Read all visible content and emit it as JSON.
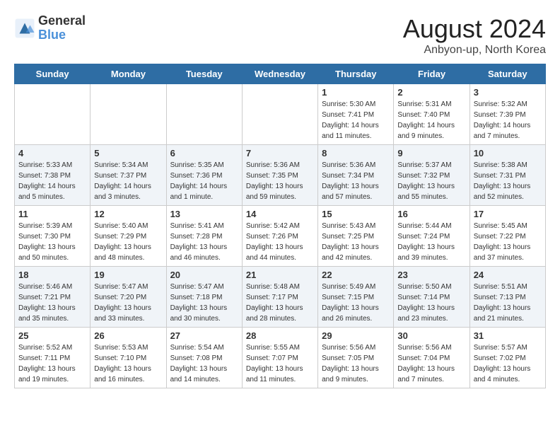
{
  "header": {
    "logo_line1": "General",
    "logo_line2": "Blue",
    "month_year": "August 2024",
    "location": "Anbyon-up, North Korea"
  },
  "days_of_week": [
    "Sunday",
    "Monday",
    "Tuesday",
    "Wednesday",
    "Thursday",
    "Friday",
    "Saturday"
  ],
  "weeks": [
    [
      {
        "day": "",
        "info": ""
      },
      {
        "day": "",
        "info": ""
      },
      {
        "day": "",
        "info": ""
      },
      {
        "day": "",
        "info": ""
      },
      {
        "day": "1",
        "info": "Sunrise: 5:30 AM\nSunset: 7:41 PM\nDaylight: 14 hours\nand 11 minutes."
      },
      {
        "day": "2",
        "info": "Sunrise: 5:31 AM\nSunset: 7:40 PM\nDaylight: 14 hours\nand 9 minutes."
      },
      {
        "day": "3",
        "info": "Sunrise: 5:32 AM\nSunset: 7:39 PM\nDaylight: 14 hours\nand 7 minutes."
      }
    ],
    [
      {
        "day": "4",
        "info": "Sunrise: 5:33 AM\nSunset: 7:38 PM\nDaylight: 14 hours\nand 5 minutes."
      },
      {
        "day": "5",
        "info": "Sunrise: 5:34 AM\nSunset: 7:37 PM\nDaylight: 14 hours\nand 3 minutes."
      },
      {
        "day": "6",
        "info": "Sunrise: 5:35 AM\nSunset: 7:36 PM\nDaylight: 14 hours\nand 1 minute."
      },
      {
        "day": "7",
        "info": "Sunrise: 5:36 AM\nSunset: 7:35 PM\nDaylight: 13 hours\nand 59 minutes."
      },
      {
        "day": "8",
        "info": "Sunrise: 5:36 AM\nSunset: 7:34 PM\nDaylight: 13 hours\nand 57 minutes."
      },
      {
        "day": "9",
        "info": "Sunrise: 5:37 AM\nSunset: 7:32 PM\nDaylight: 13 hours\nand 55 minutes."
      },
      {
        "day": "10",
        "info": "Sunrise: 5:38 AM\nSunset: 7:31 PM\nDaylight: 13 hours\nand 52 minutes."
      }
    ],
    [
      {
        "day": "11",
        "info": "Sunrise: 5:39 AM\nSunset: 7:30 PM\nDaylight: 13 hours\nand 50 minutes."
      },
      {
        "day": "12",
        "info": "Sunrise: 5:40 AM\nSunset: 7:29 PM\nDaylight: 13 hours\nand 48 minutes."
      },
      {
        "day": "13",
        "info": "Sunrise: 5:41 AM\nSunset: 7:28 PM\nDaylight: 13 hours\nand 46 minutes."
      },
      {
        "day": "14",
        "info": "Sunrise: 5:42 AM\nSunset: 7:26 PM\nDaylight: 13 hours\nand 44 minutes."
      },
      {
        "day": "15",
        "info": "Sunrise: 5:43 AM\nSunset: 7:25 PM\nDaylight: 13 hours\nand 42 minutes."
      },
      {
        "day": "16",
        "info": "Sunrise: 5:44 AM\nSunset: 7:24 PM\nDaylight: 13 hours\nand 39 minutes."
      },
      {
        "day": "17",
        "info": "Sunrise: 5:45 AM\nSunset: 7:22 PM\nDaylight: 13 hours\nand 37 minutes."
      }
    ],
    [
      {
        "day": "18",
        "info": "Sunrise: 5:46 AM\nSunset: 7:21 PM\nDaylight: 13 hours\nand 35 minutes."
      },
      {
        "day": "19",
        "info": "Sunrise: 5:47 AM\nSunset: 7:20 PM\nDaylight: 13 hours\nand 33 minutes."
      },
      {
        "day": "20",
        "info": "Sunrise: 5:47 AM\nSunset: 7:18 PM\nDaylight: 13 hours\nand 30 minutes."
      },
      {
        "day": "21",
        "info": "Sunrise: 5:48 AM\nSunset: 7:17 PM\nDaylight: 13 hours\nand 28 minutes."
      },
      {
        "day": "22",
        "info": "Sunrise: 5:49 AM\nSunset: 7:15 PM\nDaylight: 13 hours\nand 26 minutes."
      },
      {
        "day": "23",
        "info": "Sunrise: 5:50 AM\nSunset: 7:14 PM\nDaylight: 13 hours\nand 23 minutes."
      },
      {
        "day": "24",
        "info": "Sunrise: 5:51 AM\nSunset: 7:13 PM\nDaylight: 13 hours\nand 21 minutes."
      }
    ],
    [
      {
        "day": "25",
        "info": "Sunrise: 5:52 AM\nSunset: 7:11 PM\nDaylight: 13 hours\nand 19 minutes."
      },
      {
        "day": "26",
        "info": "Sunrise: 5:53 AM\nSunset: 7:10 PM\nDaylight: 13 hours\nand 16 minutes."
      },
      {
        "day": "27",
        "info": "Sunrise: 5:54 AM\nSunset: 7:08 PM\nDaylight: 13 hours\nand 14 minutes."
      },
      {
        "day": "28",
        "info": "Sunrise: 5:55 AM\nSunset: 7:07 PM\nDaylight: 13 hours\nand 11 minutes."
      },
      {
        "day": "29",
        "info": "Sunrise: 5:56 AM\nSunset: 7:05 PM\nDaylight: 13 hours\nand 9 minutes."
      },
      {
        "day": "30",
        "info": "Sunrise: 5:56 AM\nSunset: 7:04 PM\nDaylight: 13 hours\nand 7 minutes."
      },
      {
        "day": "31",
        "info": "Sunrise: 5:57 AM\nSunset: 7:02 PM\nDaylight: 13 hours\nand 4 minutes."
      }
    ]
  ]
}
